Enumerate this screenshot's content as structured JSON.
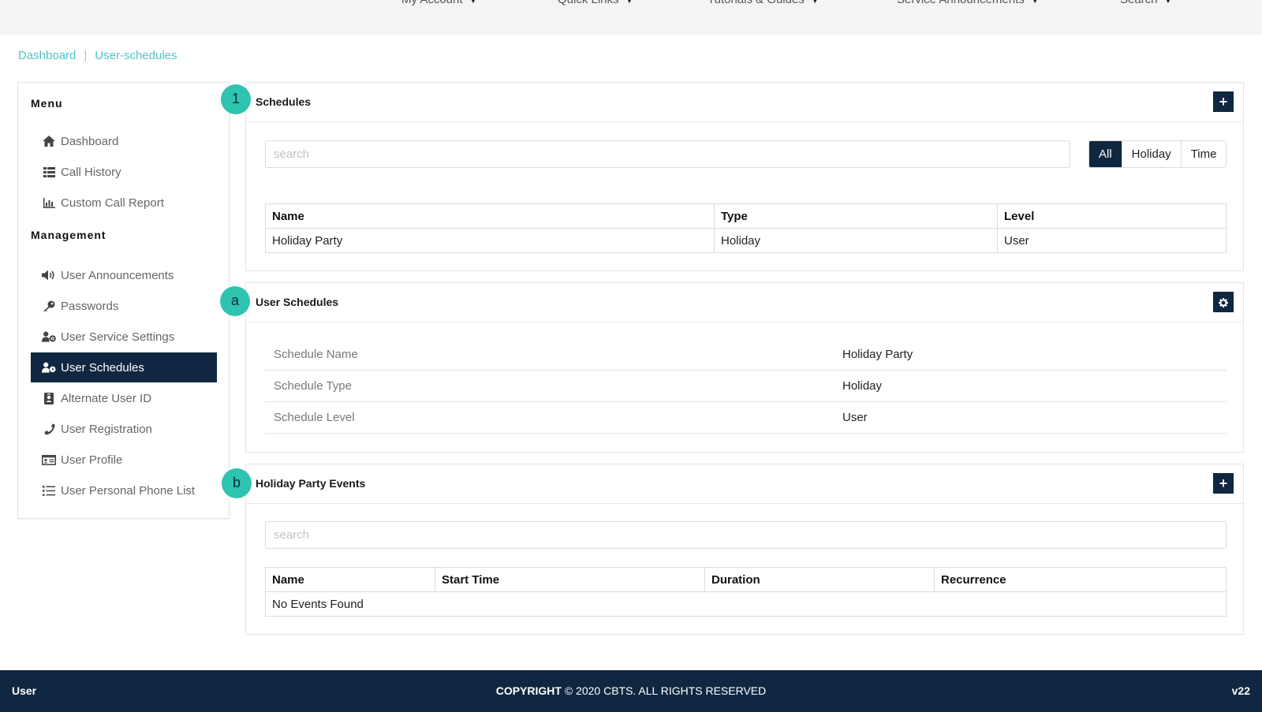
{
  "topnav": {
    "items": [
      {
        "label": "My Account"
      },
      {
        "label": "Quick Links"
      },
      {
        "label": "Tutorials & Guides"
      },
      {
        "label": "Service Announcements"
      },
      {
        "label": "Search"
      }
    ]
  },
  "breadcrumb": {
    "items": [
      "Dashboard",
      "User-schedules"
    ],
    "separator": "|"
  },
  "sidebar": {
    "menu_heading": "Menu",
    "menu_items": [
      {
        "label": "Dashboard",
        "icon": "home-icon"
      },
      {
        "label": "Call History",
        "icon": "list-table-icon"
      },
      {
        "label": "Custom Call Report",
        "icon": "bar-chart-icon"
      }
    ],
    "management_heading": "Management",
    "management_items": [
      {
        "label": "User Announcements",
        "icon": "speaker-icon"
      },
      {
        "label": "Passwords",
        "icon": "key-icon"
      },
      {
        "label": "User Service Settings",
        "icon": "user-gear-icon"
      },
      {
        "label": "User Schedules",
        "icon": "user-clock-icon",
        "active": true
      },
      {
        "label": "Alternate User ID",
        "icon": "id-badge-icon"
      },
      {
        "label": "User Registration",
        "icon": "phone-icon"
      },
      {
        "label": "User Profile",
        "icon": "id-card-icon"
      },
      {
        "label": "User Personal Phone List",
        "icon": "list-icon"
      }
    ]
  },
  "schedules_panel": {
    "marker": "1",
    "title": "Schedules",
    "add_icon": "plus-icon",
    "search_placeholder": "search",
    "filters": [
      "All",
      "Holiday",
      "Time"
    ],
    "active_filter": "All",
    "columns": [
      "Name",
      "Type",
      "Level"
    ],
    "rows": [
      [
        "Holiday Party",
        "Holiday",
        "User"
      ]
    ]
  },
  "user_schedules_panel": {
    "marker": "a",
    "title": "User Schedules",
    "settings_icon": "gear-icon",
    "fields": [
      {
        "key": "Schedule Name",
        "value": "Holiday Party"
      },
      {
        "key": "Schedule Type",
        "value": "Holiday"
      },
      {
        "key": "Schedule Level",
        "value": "User"
      }
    ]
  },
  "events_panel": {
    "marker": "b",
    "title": "Holiday Party Events",
    "add_icon": "plus-icon",
    "search_placeholder": "search",
    "columns": [
      "Name",
      "Start Time",
      "Duration",
      "Recurrence"
    ],
    "empty_text": "No Events Found"
  },
  "footer": {
    "left": "User",
    "copyright_label": "COPYRIGHT",
    "copyright_text": "© 2020 CBTS. ALL RIGHTS RESERVED",
    "version": "v22"
  },
  "colors": {
    "navy": "#0f2740",
    "teal_marker": "#2ec4b0",
    "link": "#4fc3c8"
  }
}
